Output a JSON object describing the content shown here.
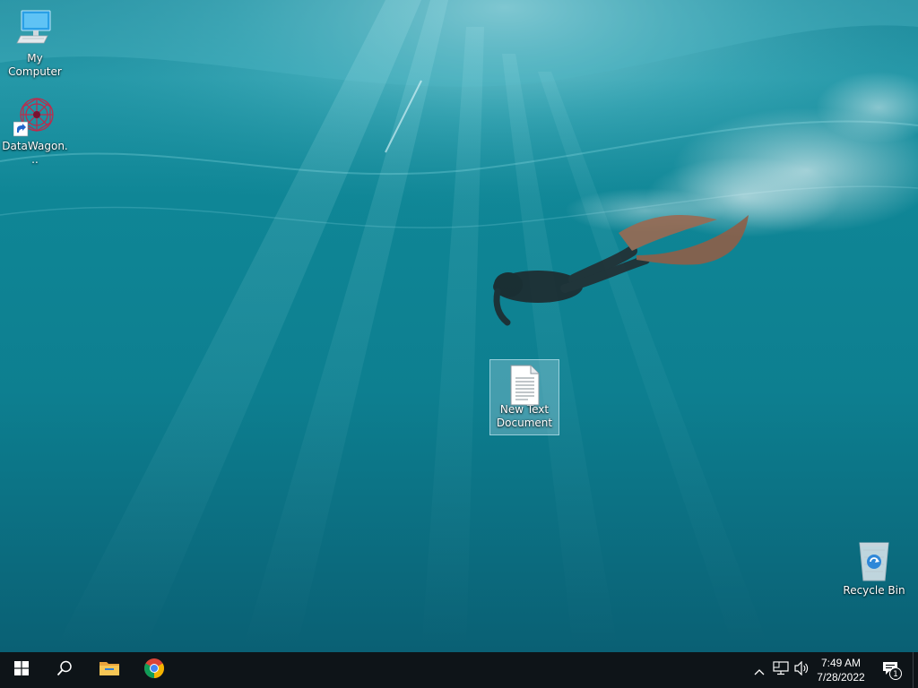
{
  "desktop": {
    "icons": [
      {
        "label": "My Computer",
        "icon": "computer-icon"
      },
      {
        "label": "DataWagon...",
        "icon": "datawagon-shortcut-icon"
      },
      {
        "label": "New Text Document",
        "icon": "text-document-icon",
        "selected": true
      },
      {
        "label": "Recycle Bin",
        "icon": "recycle-bin-icon"
      }
    ]
  },
  "taskbar": {
    "start": {
      "icon": "windows-logo-icon"
    },
    "search": {
      "icon": "search-icon"
    },
    "pinned": [
      {
        "app": "File Explorer",
        "icon": "folder-icon"
      },
      {
        "app": "Google Chrome",
        "icon": "chrome-icon"
      }
    ],
    "tray": {
      "chevron_icon": "chevron-up-icon",
      "network_icon": "network-icon",
      "volume_icon": "speaker-icon",
      "time": "7:49 AM",
      "date": "7/28/2022",
      "notifications_icon": "action-center-icon",
      "notifications_count": "1"
    }
  },
  "colors": {
    "taskbar_bg": "#0e1418",
    "water_light": "#3ab7c6",
    "water_deep": "#0a6478",
    "selection": "#add8e6"
  }
}
